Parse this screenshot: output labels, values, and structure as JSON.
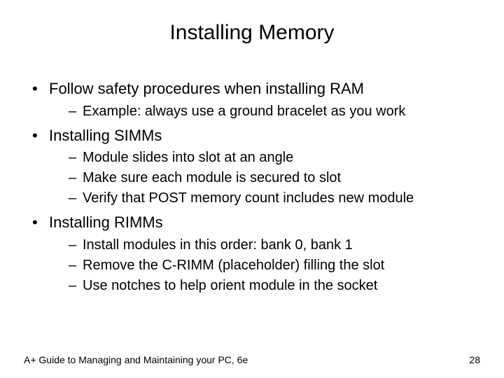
{
  "title": "Installing Memory",
  "bullets": [
    {
      "text": "Follow safety procedures when installing RAM",
      "sub": [
        "Example: always use a ground bracelet as you work"
      ]
    },
    {
      "text": "Installing SIMMs",
      "sub": [
        "Module slides into slot at an angle",
        "Make sure each module is secured to slot",
        "Verify that POST memory count includes new module"
      ]
    },
    {
      "text": "Installing RIMMs",
      "sub": [
        "Install modules in this order: bank 0, bank 1",
        "Remove the C-RIMM (placeholder) filling the slot",
        "Use notches to help orient module in the socket"
      ]
    }
  ],
  "footer": {
    "left": "A+ Guide to Managing and Maintaining your PC, 6e",
    "right": "28"
  }
}
